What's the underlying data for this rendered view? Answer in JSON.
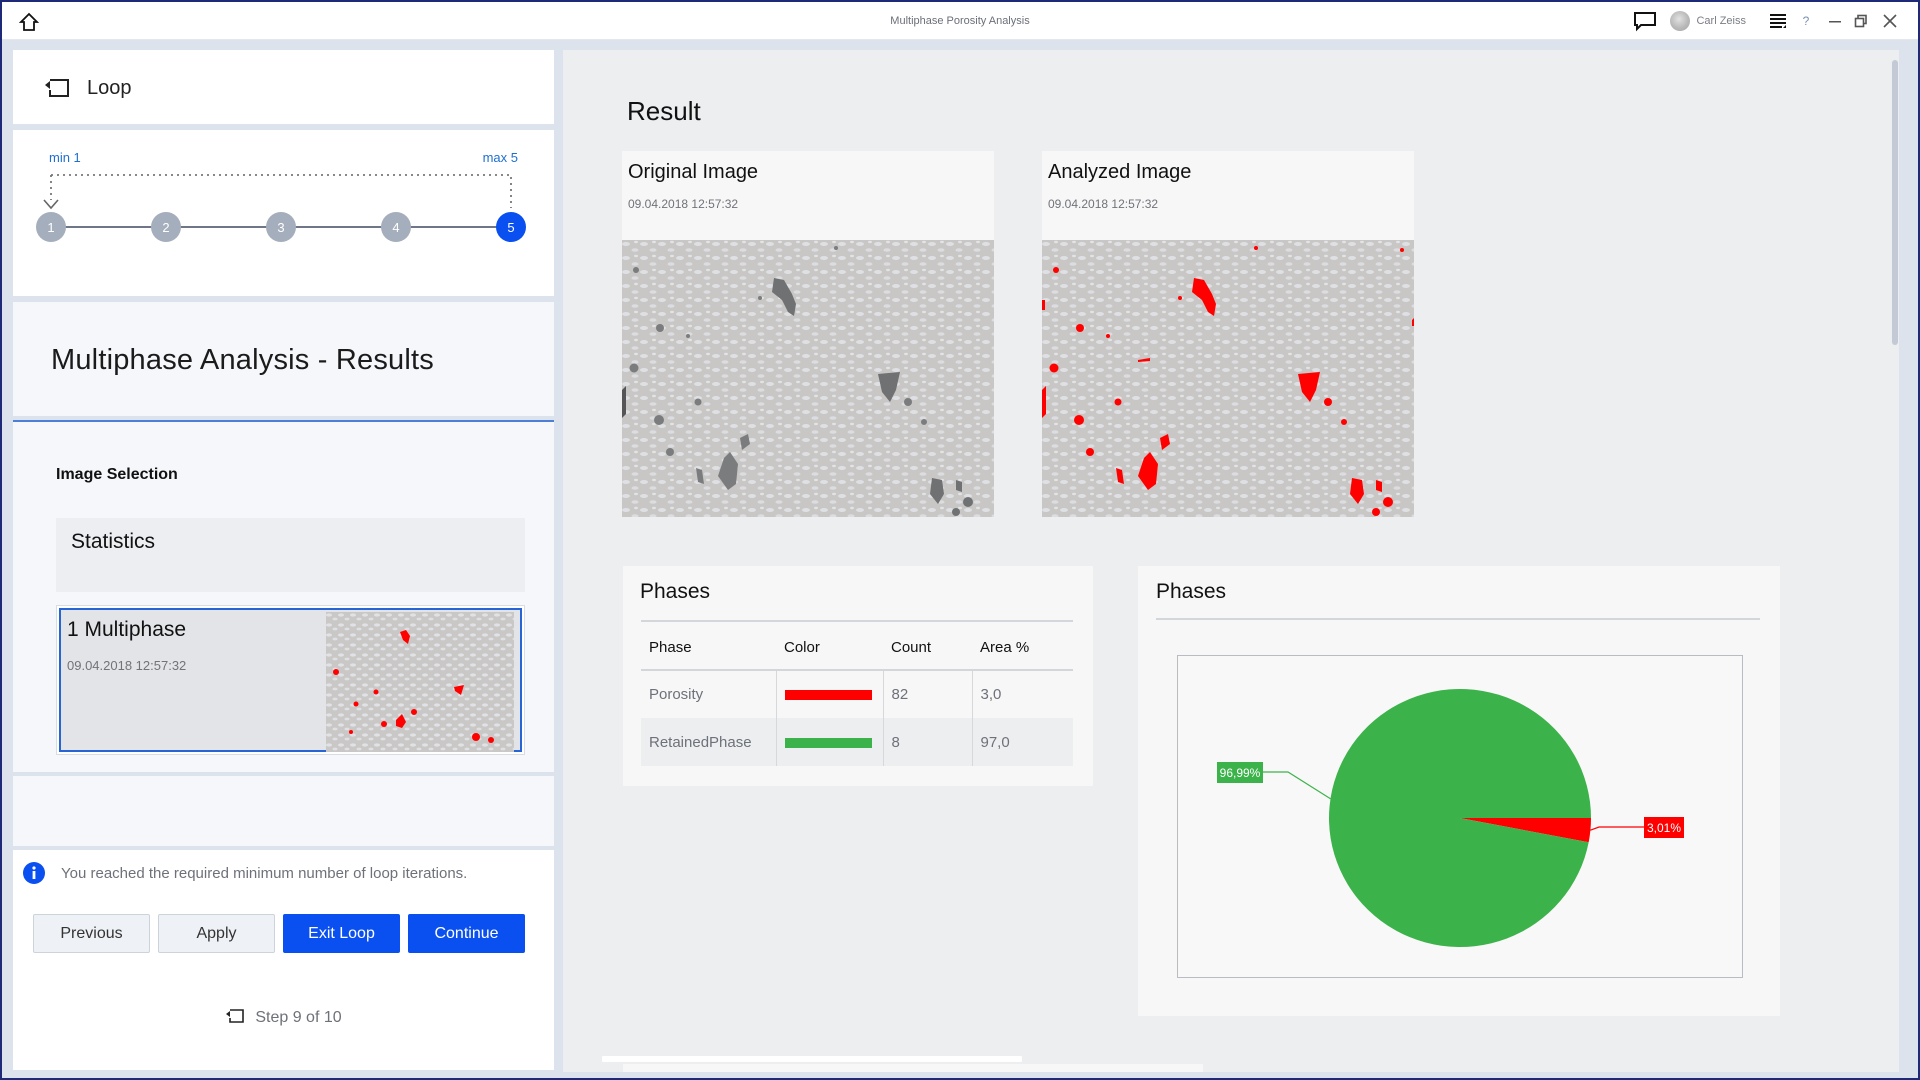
{
  "window": {
    "title": "Multiphase Porosity Analysis",
    "user_name": "Carl Zeiss",
    "help_label": "?",
    "icons": [
      "home-icon",
      "chat-icon",
      "avatar",
      "menu-icon",
      "help-icon",
      "minimize-icon",
      "restore-icon",
      "close-icon"
    ]
  },
  "sidebar": {
    "loop_label": "Loop",
    "stepper": {
      "min_label": "min 1",
      "max_label": "max 5",
      "steps": [
        "1",
        "2",
        "3",
        "4",
        "5"
      ],
      "active_step": 5
    },
    "section_title": "Multiphase Analysis - Results",
    "image_selection": {
      "label": "Image Selection",
      "statistics_label": "Statistics",
      "items": [
        {
          "title": "1 Multiphase",
          "timestamp": "09.04.2018 12:57:32",
          "selected": true
        }
      ]
    },
    "info_message": "You reached the required minimum number of loop iterations.",
    "buttons": {
      "previous": "Previous",
      "apply": "Apply",
      "exit_loop": "Exit Loop",
      "continue": "Continue"
    },
    "step_indicator": "Step 9 of 10"
  },
  "main": {
    "result_title": "Result",
    "original_image": {
      "title": "Original Image",
      "timestamp": "09.04.2018 12:57:32"
    },
    "analyzed_image": {
      "title": "Analyzed Image",
      "timestamp": "09.04.2018 12:57:32"
    },
    "phases_table": {
      "title": "Phases",
      "columns": [
        "Phase",
        "Color",
        "Count",
        "Area %"
      ],
      "rows": [
        {
          "phase": "Porosity",
          "color": "#ff0000",
          "count": "82",
          "area": "3,0"
        },
        {
          "phase": "RetainedPhase",
          "color": "#3cb34a",
          "count": "8",
          "area": "97,0"
        }
      ]
    },
    "phases_chart_title": "Phases"
  },
  "colors": {
    "accent": "#0a4ff0",
    "porosity": "#ff0000",
    "retained": "#3cb34a",
    "info": "#0a4ff0"
  },
  "chart_data": {
    "type": "pie",
    "title": "Phases",
    "categories": [
      "RetainedPhase",
      "Porosity"
    ],
    "values": [
      96.99,
      3.01
    ],
    "labels": [
      "96,99%",
      "3,01%"
    ],
    "colors": [
      "#3cb34a",
      "#ff0000"
    ],
    "legend": "none"
  }
}
